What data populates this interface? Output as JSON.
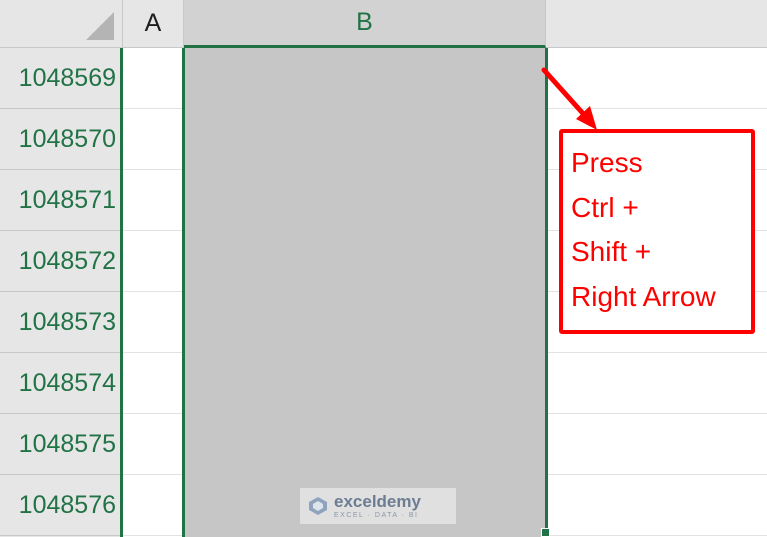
{
  "spreadsheet": {
    "columns": [
      {
        "label": "A"
      },
      {
        "label": "B"
      }
    ],
    "rows": [
      {
        "label": "1048569"
      },
      {
        "label": "1048570"
      },
      {
        "label": "1048571"
      },
      {
        "label": "1048572"
      },
      {
        "label": "1048573"
      },
      {
        "label": "1048574"
      },
      {
        "label": "1048575"
      },
      {
        "label": "1048576"
      }
    ],
    "selected_column": "B",
    "accent_color": "#217346",
    "selection_fill": "#c6c6c6"
  },
  "callout": {
    "lines": [
      "Press",
      "Ctrl +",
      "Shift +",
      "Right Arrow"
    ],
    "color": "#ff0000"
  },
  "watermark": {
    "brand": "exceldemy",
    "tagline": "EXCEL · DATA · BI"
  }
}
